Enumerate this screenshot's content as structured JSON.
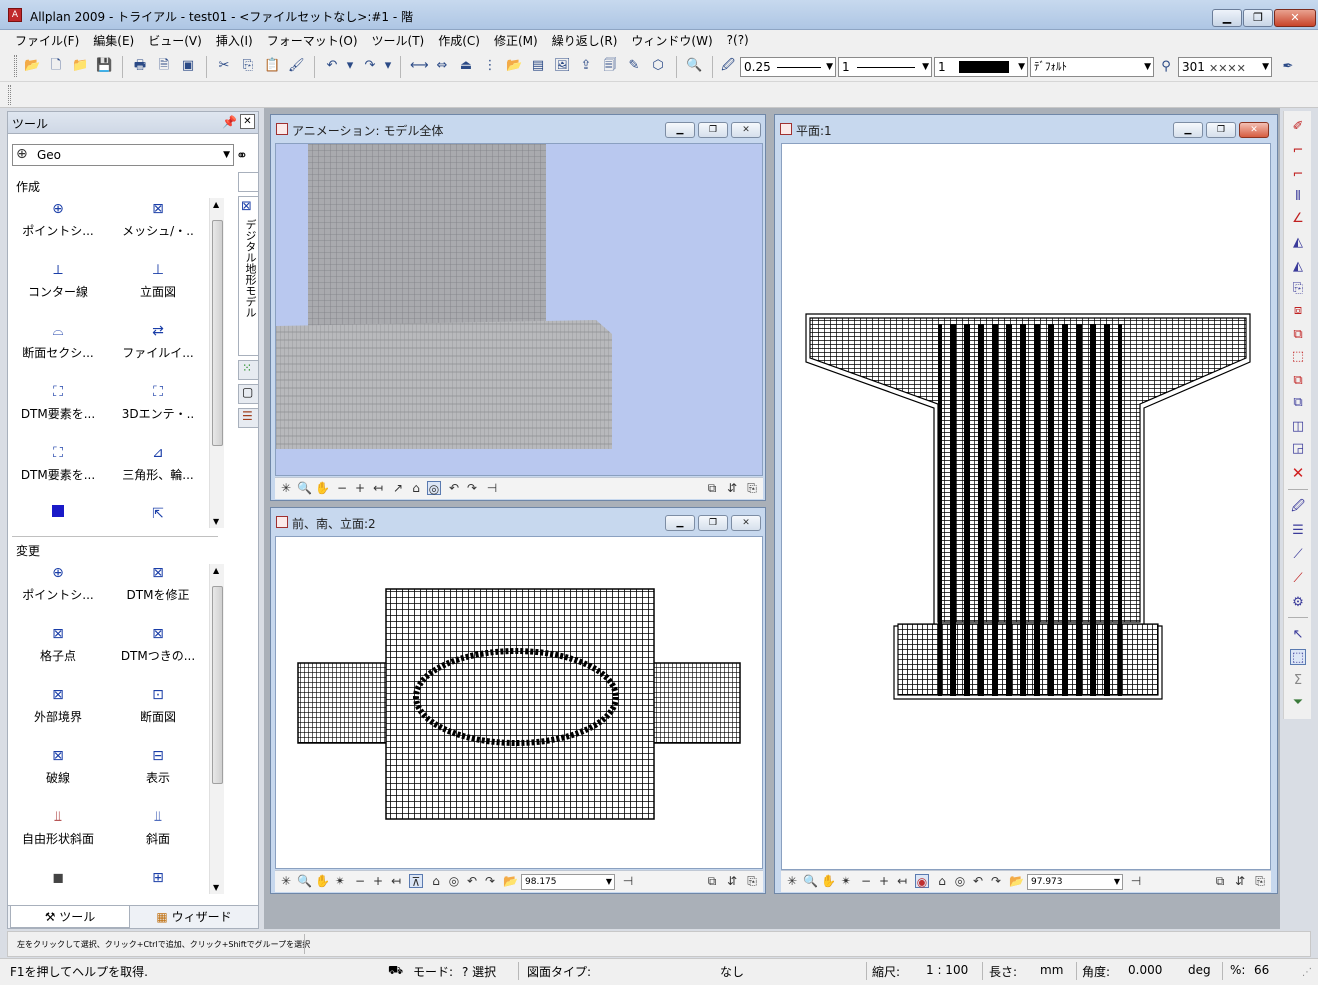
{
  "window": {
    "title": "Allplan 2009 - トライアル - test01 - <ファイルセットなし>:#1 - 階"
  },
  "menu": [
    "ファイル(F)",
    "編集(E)",
    "ビュー(V)",
    "挿入(I)",
    "フォーマット(O)",
    "ツール(T)",
    "作成(C)",
    "修正(M)",
    "繰り返し(R)",
    "ウィンドウ(W)",
    "?(?)"
  ],
  "toolbar": {
    "pen_value": "0.25",
    "line_value": "1",
    "color_value": "1",
    "layer_value": "ﾃﾞﾌｫﾙﾄ",
    "hatch_value": "301"
  },
  "tools_panel": {
    "title": "ツール",
    "module": "Geo",
    "vertical_tab": "デジタル地形モデル",
    "create_title": "作成",
    "create_items": [
      "ポイントシ...",
      "メッシュ/・..",
      "コンター線",
      "立面図",
      "断面セクシ...",
      "ファイルイ...",
      "DTM要素を...",
      "3Dエンテ・..",
      "DTM要素を...",
      "三角形、輪...",
      "",
      ""
    ],
    "modify_title": "変更",
    "modify_items": [
      "ポイントシ...",
      "DTMを修正",
      "格子点",
      "DTMつきの...",
      "外部境界",
      "断面図",
      "破線",
      "表示",
      "自由形状斜面",
      "斜面",
      "",
      ""
    ],
    "tab_tools": "ツール",
    "tab_wizard": "ウィザード"
  },
  "views": {
    "animation": {
      "title": "アニメーション: モデル全体"
    },
    "front": {
      "title": "前、南、立面:2",
      "scale": "98.175"
    },
    "plan": {
      "title": "平面:1",
      "scale": "97.973"
    }
  },
  "hint": "左をクリックして選択、クリック+Ctrlで追加、クリック+Shiftでグループを選択",
  "status": {
    "help": "F1を押してヘルプを取得.",
    "mode_label": "モード:",
    "mode_value": "? 選択",
    "drawing_type_label": "図面タイプ:",
    "drawing_type_value": "なし",
    "scale_label": "縮尺:",
    "scale_value": "1 : 100",
    "length_label": "長さ:",
    "length_unit": "mm",
    "angle_label": "角度:",
    "angle_value": "0.000",
    "angle_unit": "deg",
    "percent_label": "%:",
    "percent_value": "66"
  },
  "colors": {
    "titlebar": "#aec6e4",
    "animation_bg": "#b9c8ef",
    "delete_red": "#d02020"
  }
}
